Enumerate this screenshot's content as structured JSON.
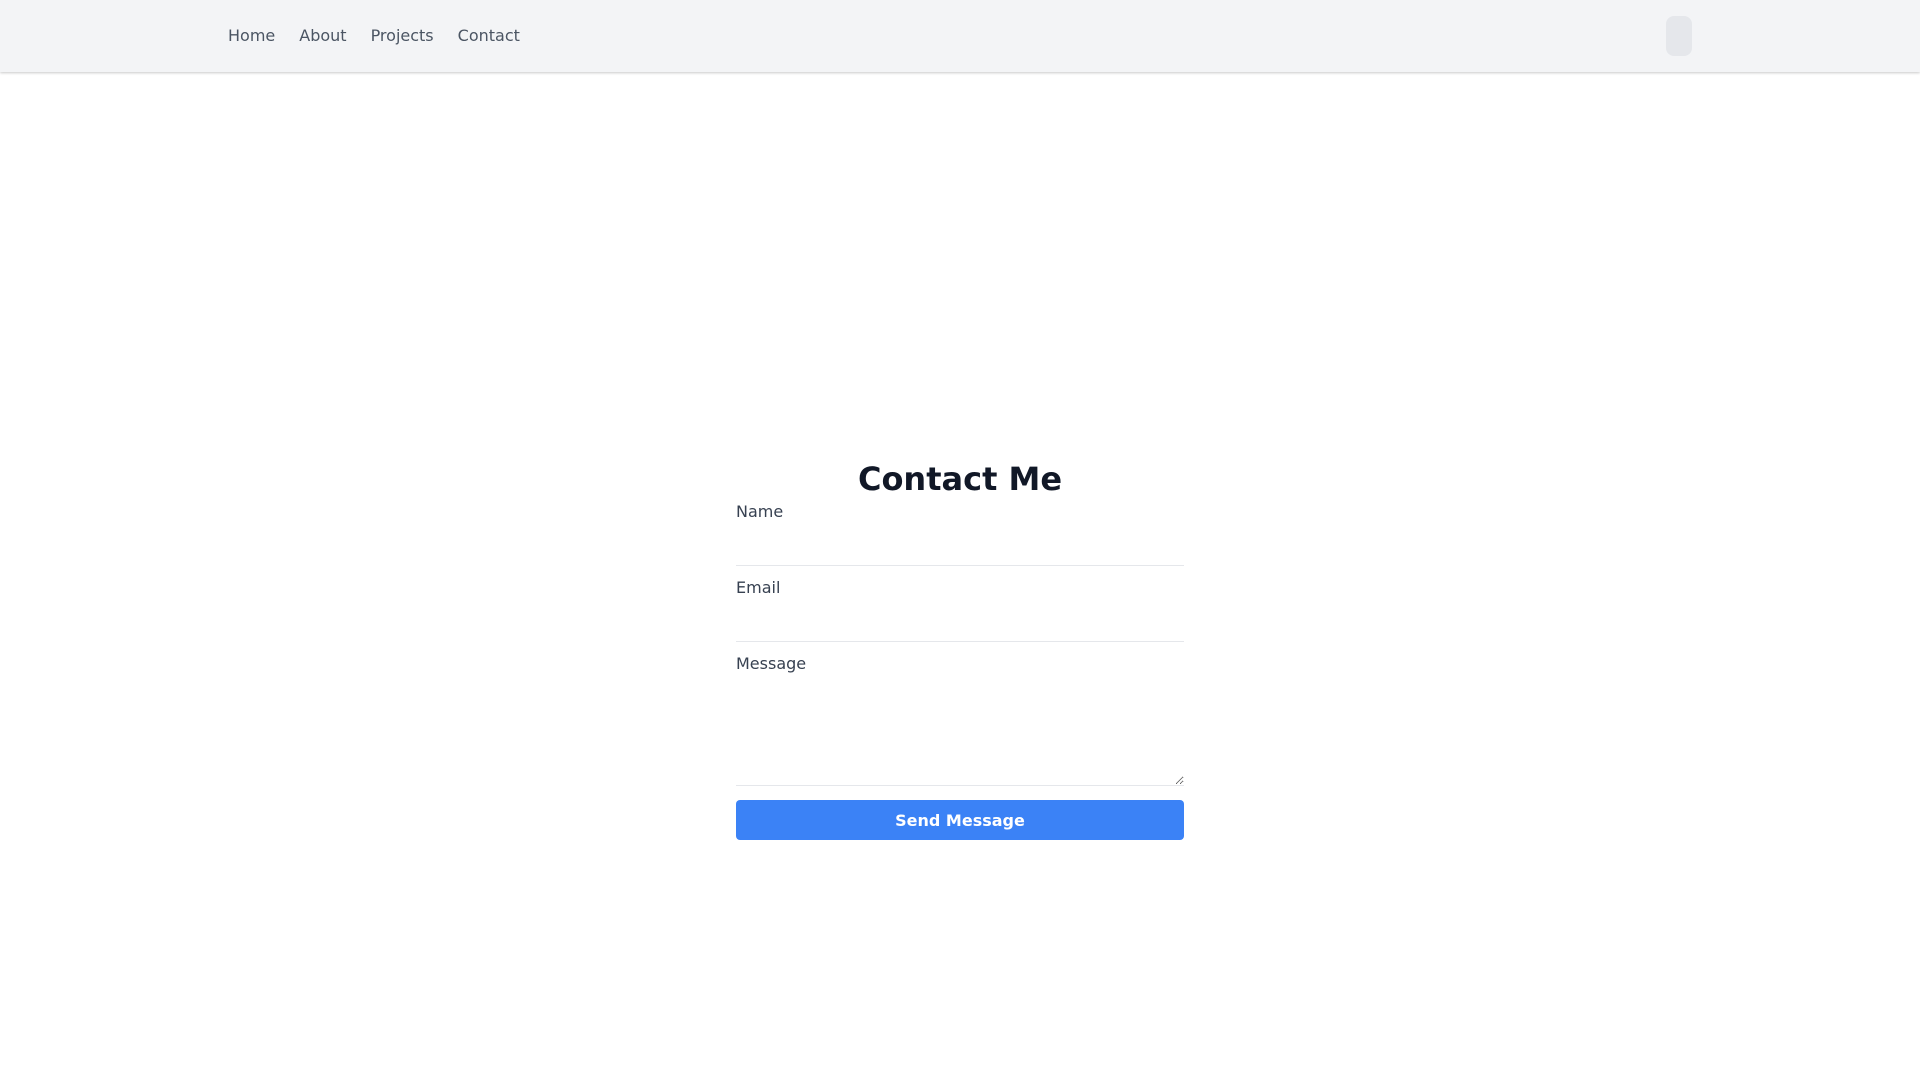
{
  "nav": {
    "items": [
      {
        "label": "Home"
      },
      {
        "label": "About"
      },
      {
        "label": "Projects"
      },
      {
        "label": "Contact"
      }
    ]
  },
  "colors": {
    "navbar_bg": "#f3f4f6",
    "toggle_bg": "#e5e7eb",
    "accent": "#3b82f6"
  },
  "contact": {
    "title": "Contact Me",
    "name_label": "Name",
    "name_value": "",
    "email_label": "Email",
    "email_value": "",
    "message_label": "Message",
    "message_value": "",
    "submit_label": "Send Message"
  }
}
